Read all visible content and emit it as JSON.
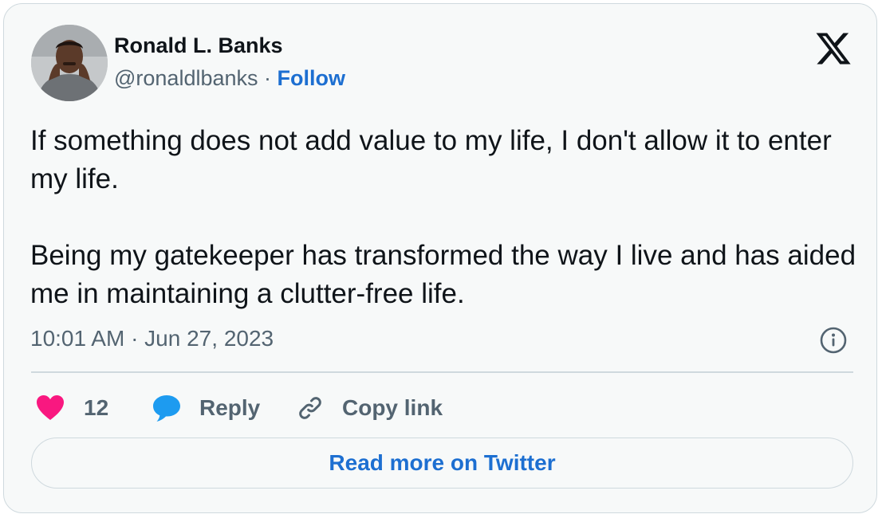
{
  "author": {
    "name": "Ronald L. Banks",
    "handle": "@ronaldlbanks",
    "separator": "·",
    "follow_label": "Follow"
  },
  "tweet": {
    "paragraphs": [
      "If something does not add value to my life, I don't allow it to enter my life.",
      "Being my gatekeeper has transformed the way I live and has aided me in maintaining a clutter-free life."
    ],
    "timestamp": "10:01 AM · Jun 27, 2023"
  },
  "actions": {
    "like_count": "12",
    "reply_label": "Reply",
    "copy_link_label": "Copy link"
  },
  "read_more_label": "Read more on Twitter",
  "icons": {
    "brand": "x-logo-icon",
    "info": "info-icon",
    "like": "heart-icon",
    "reply": "speech-bubble-icon",
    "copy": "link-icon"
  },
  "colors": {
    "accent": "#1d6fd1",
    "like": "#f91880",
    "reply": "#1d9bf0",
    "text": "#0f1419",
    "muted": "#536471",
    "border": "#cfd9de",
    "background": "#f7f9f9"
  }
}
